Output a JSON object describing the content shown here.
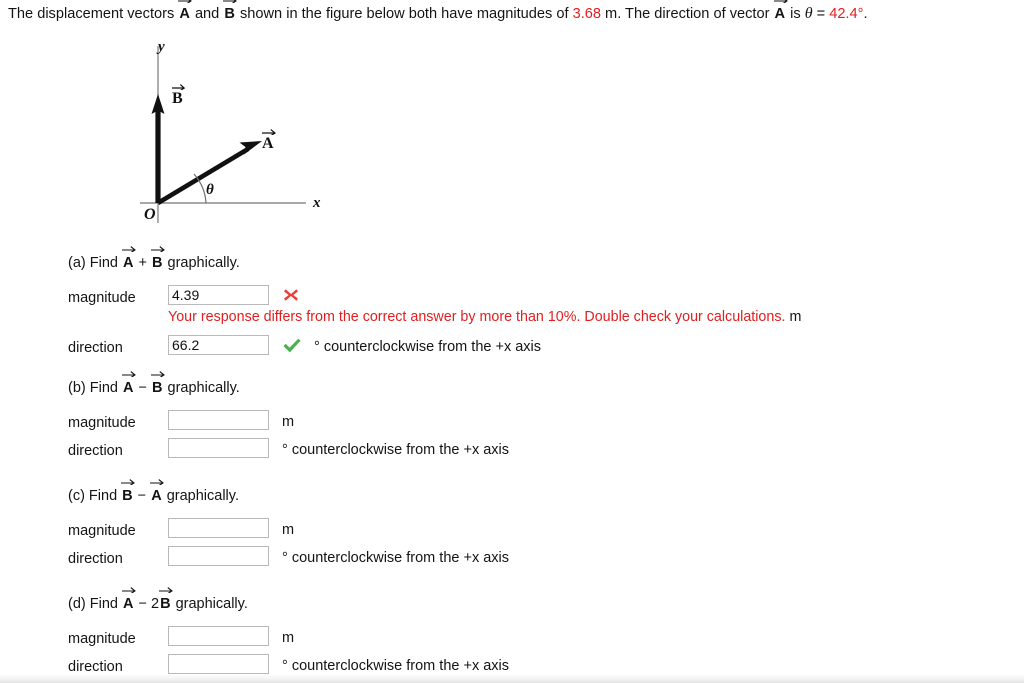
{
  "problem": {
    "text_1": "The displacement vectors ",
    "vec_a": "A",
    "text_2": " and ",
    "vec_b": "B",
    "text_3": " shown in the figure below both have magnitudes of ",
    "magnitude_value": "3.68",
    "text_4": " m. The direction of vector ",
    "vec_a2": "A",
    "text_5": " is ",
    "theta_symbol": "θ",
    "equals": " = ",
    "angle_value": "42.4°",
    "period": ".",
    "accent_color": "#e02020"
  },
  "figure": {
    "y_axis_label": "y",
    "x_axis_label": "x",
    "origin_label": "O",
    "vector_b_label": "B",
    "vector_a_label": "A",
    "angle_label": "θ"
  },
  "parts": [
    {
      "id": "a",
      "title_prefix": "(a) Find ",
      "vec_left": "A",
      "operator": " + ",
      "vec_right": "B",
      "title_suffix": " graphically.",
      "rows": [
        {
          "label": "magnitude",
          "value": "4.39",
          "placeholder": "",
          "mark": "incorrect-icon",
          "unit": "",
          "feedback": "Your response differs from the correct answer by more than 10%. Double check your calculations.",
          "feedback_unit": "m"
        },
        {
          "label": "direction",
          "value": "66.2",
          "placeholder": "",
          "mark": "correct-icon",
          "unit": "° counterclockwise from the +x axis",
          "feedback": "",
          "feedback_unit": ""
        }
      ]
    },
    {
      "id": "b",
      "title_prefix": "(b) Find ",
      "vec_left": "A",
      "operator": " − ",
      "vec_right": "B",
      "title_suffix": " graphically.",
      "rows": [
        {
          "label": "magnitude",
          "value": "",
          "placeholder": "",
          "mark": "",
          "unit": "m",
          "feedback": "",
          "feedback_unit": ""
        },
        {
          "label": "direction",
          "value": "",
          "placeholder": "",
          "mark": "",
          "unit": "° counterclockwise from the +x axis",
          "feedback": "",
          "feedback_unit": ""
        }
      ]
    },
    {
      "id": "c",
      "title_prefix": "(c) Find ",
      "vec_left": "B",
      "operator": " − ",
      "vec_right": "A",
      "title_suffix": " graphically.",
      "rows": [
        {
          "label": "magnitude",
          "value": "",
          "placeholder": "",
          "mark": "",
          "unit": "m",
          "feedback": "",
          "feedback_unit": ""
        },
        {
          "label": "direction",
          "value": "",
          "placeholder": "",
          "mark": "",
          "unit": "° counterclockwise from the +x axis",
          "feedback": "",
          "feedback_unit": ""
        }
      ]
    },
    {
      "id": "d",
      "title_prefix": "(d) Find ",
      "vec_left": "A",
      "operator": " − 2",
      "vec_right": "B",
      "title_suffix": " graphically.",
      "rows": [
        {
          "label": "magnitude",
          "value": "",
          "placeholder": "",
          "mark": "",
          "unit": "m",
          "feedback": "",
          "feedback_unit": ""
        },
        {
          "label": "direction",
          "value": "",
          "placeholder": "",
          "mark": "",
          "unit": "° counterclockwise from the +x axis",
          "feedback": "",
          "feedback_unit": ""
        }
      ]
    }
  ],
  "colors": {
    "incorrect": "#e8413a",
    "correct": "#4caf50",
    "error_text": "#e02020",
    "input_border": "#b9b9b9"
  }
}
